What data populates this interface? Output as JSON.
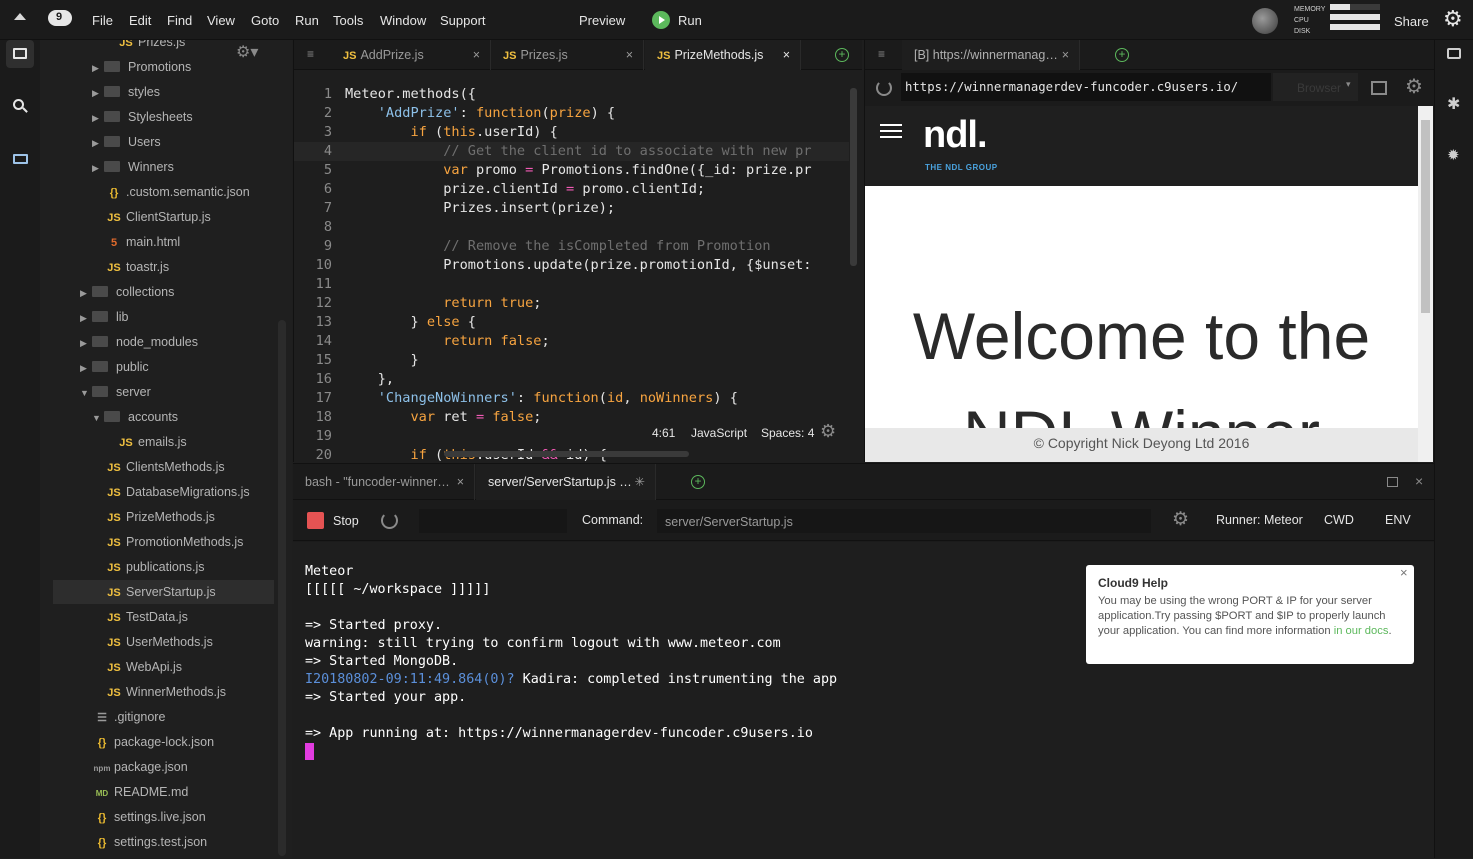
{
  "menu": {
    "items": [
      "File",
      "Edit",
      "Find",
      "View",
      "Goto",
      "Run",
      "Tools",
      "Window",
      "Support"
    ],
    "preview": "Preview",
    "run": "Run",
    "share": "Share",
    "metrics": [
      "MEMORY",
      "CPU",
      "DISK"
    ]
  },
  "tree": {
    "items": [
      {
        "label": "Prizes.js",
        "type": "js",
        "indent": 2
      },
      {
        "label": "Promotions",
        "type": "folder",
        "indent": 1
      },
      {
        "label": "styles",
        "type": "folder",
        "indent": 1
      },
      {
        "label": "Stylesheets",
        "type": "folder",
        "indent": 1
      },
      {
        "label": "Users",
        "type": "folder",
        "indent": 1
      },
      {
        "label": "Winners",
        "type": "folder",
        "indent": 1
      },
      {
        "label": ".custom.semantic.json",
        "type": "json",
        "indent": 1
      },
      {
        "label": "ClientStartup.js",
        "type": "js",
        "indent": 1
      },
      {
        "label": "main.html",
        "type": "html",
        "indent": 1
      },
      {
        "label": "toastr.js",
        "type": "js",
        "indent": 1
      },
      {
        "label": "collections",
        "type": "folder",
        "indent": 0
      },
      {
        "label": "lib",
        "type": "folder",
        "indent": 0
      },
      {
        "label": "node_modules",
        "type": "folder",
        "indent": 0
      },
      {
        "label": "public",
        "type": "folder",
        "indent": 0
      },
      {
        "label": "server",
        "type": "folder-open",
        "indent": 0
      },
      {
        "label": "accounts",
        "type": "folder-open",
        "indent": 1
      },
      {
        "label": "emails.js",
        "type": "js",
        "indent": 2
      },
      {
        "label": "ClientsMethods.js",
        "type": "js",
        "indent": 1
      },
      {
        "label": "DatabaseMigrations.js",
        "type": "js",
        "indent": 1
      },
      {
        "label": "PrizeMethods.js",
        "type": "js",
        "indent": 1
      },
      {
        "label": "PromotionMethods.js",
        "type": "js",
        "indent": 1
      },
      {
        "label": "publications.js",
        "type": "js",
        "indent": 1
      },
      {
        "label": "ServerStartup.js",
        "type": "js",
        "indent": 1,
        "selected": true
      },
      {
        "label": "TestData.js",
        "type": "js",
        "indent": 1
      },
      {
        "label": "UserMethods.js",
        "type": "js",
        "indent": 1
      },
      {
        "label": "WebApi.js",
        "type": "js",
        "indent": 1
      },
      {
        "label": "WinnerMethods.js",
        "type": "js",
        "indent": 1
      },
      {
        "label": ".gitignore",
        "type": "file",
        "indent": 0
      },
      {
        "label": "package-lock.json",
        "type": "json",
        "indent": 0
      },
      {
        "label": "package.json",
        "type": "npm",
        "indent": 0
      },
      {
        "label": "README.md",
        "type": "md",
        "indent": 0
      },
      {
        "label": "settings.live.json",
        "type": "json",
        "indent": 0
      },
      {
        "label": "settings.test.json",
        "type": "json",
        "indent": 0
      }
    ]
  },
  "editor": {
    "tabs": [
      {
        "label": "AddPrize.js",
        "active": false
      },
      {
        "label": "Prizes.js",
        "active": false
      },
      {
        "label": "PrizeMethods.js",
        "active": true
      }
    ],
    "lines": [
      "1",
      "2",
      "3",
      "4",
      "5",
      "6",
      "7",
      "8",
      "9",
      "10",
      "11",
      "12",
      "13",
      "14",
      "15",
      "16",
      "17",
      "18",
      "19",
      "20"
    ],
    "status": {
      "pos": "4:61",
      "lang": "JavaScript",
      "spaces": "Spaces: 4"
    }
  },
  "browser": {
    "tab": "[B] https://winnermanag…",
    "url": "https://winnermanagerdev-funcoder.c9users.io/",
    "mode": "Browser",
    "logo": "ndl.",
    "logo_sub": "THE NDL GROUP",
    "hero": "Welcome to the",
    "hero2": "NDL Winner",
    "footer": "© Copyright Nick Deyong Ltd 2016"
  },
  "console": {
    "tabs": [
      "bash - \"funcoder-winner…",
      "server/ServerStartup.js …"
    ],
    "stop": "Stop",
    "command_label": "Command:",
    "command_value": "server/ServerStartup.js",
    "runner": "Runner: Meteor",
    "cwd": "CWD",
    "env": "ENV",
    "output": [
      "Meteor",
      "[[[[[ ~/workspace ]]]]]",
      "",
      "=> Started proxy.",
      "warning: still trying to confirm logout with www.meteor.com",
      "=> Started MongoDB.",
      "",
      "=> Started your app.",
      "",
      "=> App running at: https://winnermanagerdev-funcoder.c9users.io"
    ],
    "kadira_prefix": "I20180802-09:11:49.864(0)?",
    "kadira_text": " Kadira: completed instrumenting the app"
  },
  "help": {
    "title": "Cloud9 Help",
    "body": "You may be using the wrong PORT & IP for your server application.Try passing $PORT and $IP to properly launch your application. You can find more information",
    "link": "in our docs",
    "end": "."
  },
  "colors": {
    "accent_green": "#5cb85c",
    "stop_red": "#e55353",
    "cursor": "#e23ce0"
  }
}
